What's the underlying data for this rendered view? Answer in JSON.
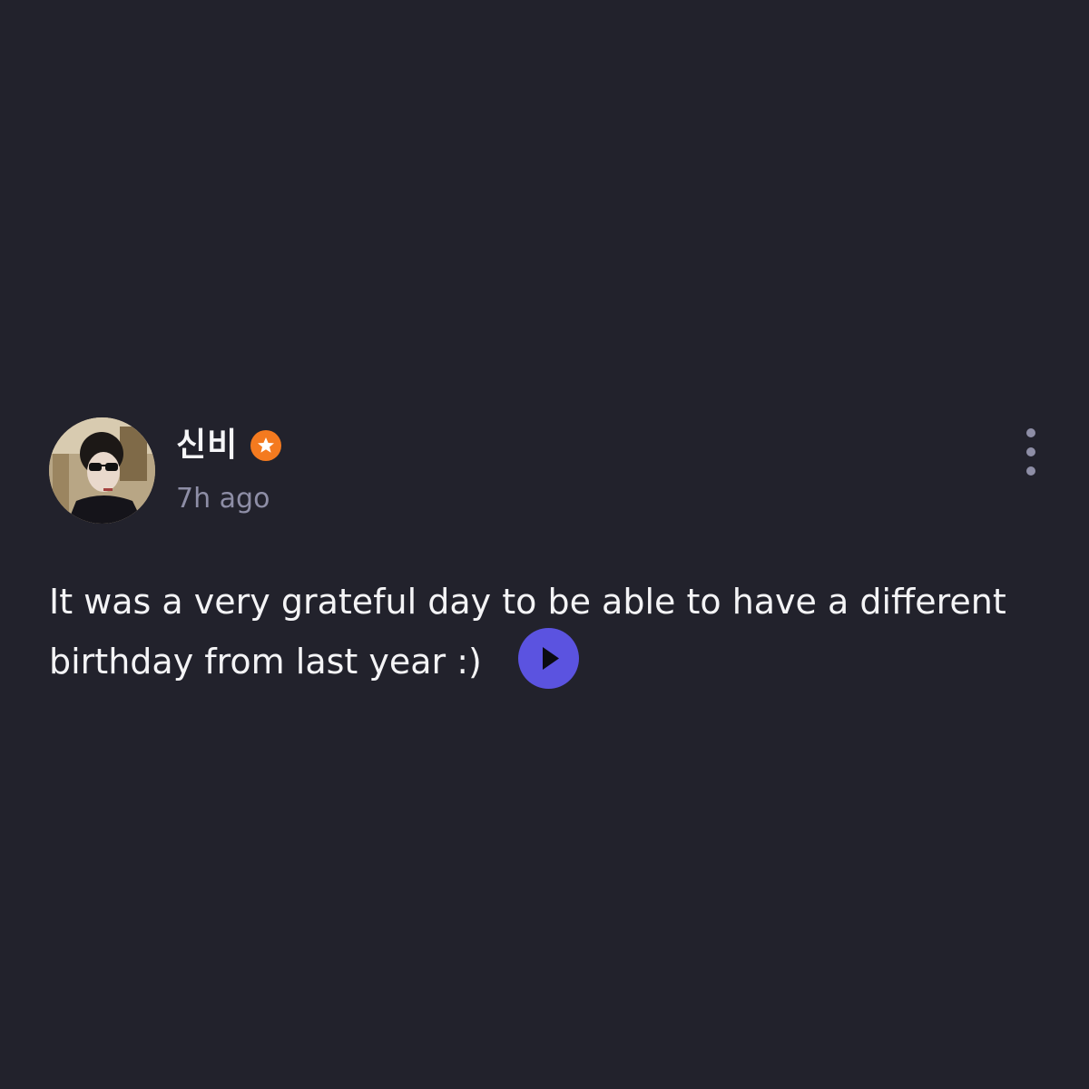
{
  "post": {
    "author": {
      "name": "신비",
      "avatar_icon": "profile-photo",
      "badge_icon": "star-badge-icon",
      "badge_color": "#f47a1f"
    },
    "timestamp": "7h ago",
    "text": "It was a very grateful day to be able to have a different birthday from last year :)",
    "actions": {
      "more_icon": "more-vertical-icon",
      "translate_icon": "play-icon"
    }
  },
  "colors": {
    "background": "#22222c",
    "text_primary": "#f4f4f6",
    "text_secondary": "#8e8ea6",
    "accent": "#5b53e0"
  }
}
